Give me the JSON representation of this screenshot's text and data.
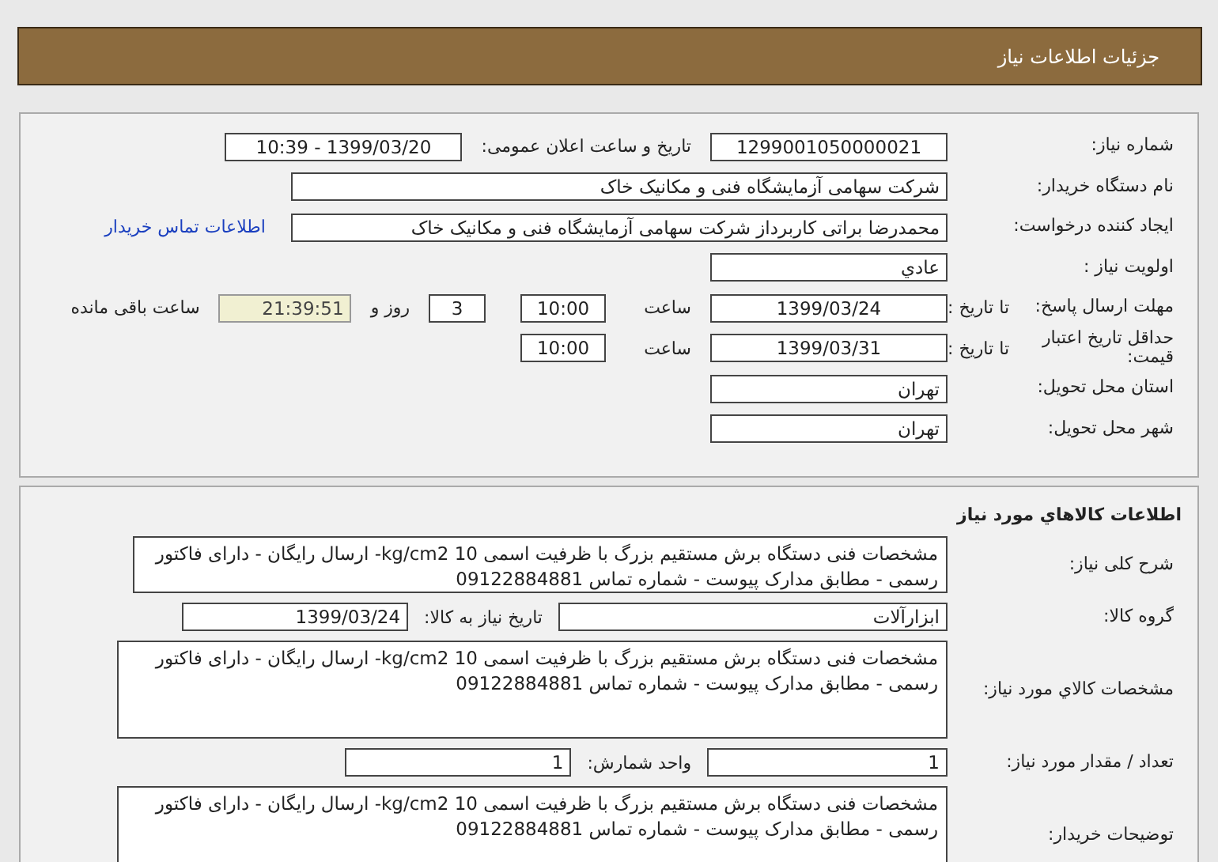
{
  "header": {
    "title": "جزئیات اطلاعات نیاز"
  },
  "request_panel": {
    "rows": [
      {
        "label": "شماره نیاز:",
        "items": [
          {
            "kind": "field",
            "value": "1299001050000021"
          },
          {
            "kind": "label",
            "text": "تاریخ و ساعت اعلان عمومی:"
          },
          {
            "kind": "field",
            "value": "1399/03/20 - 10:39"
          }
        ]
      },
      {
        "label": "نام دستگاه خریدار:",
        "items": [
          {
            "kind": "widefield",
            "value": "شرکت سهامی آزمایشگاه فنی و مکانیک خاک"
          }
        ]
      },
      {
        "label": "ایجاد کننده درخواست:",
        "items": [
          {
            "kind": "widefield",
            "value": "محمدرضا براتی کاربرداز  شرکت سهامی آزمایشگاه فنی و مکانیک خاک"
          },
          {
            "kind": "link",
            "text": "اطلاعات تماس خریدار"
          }
        ]
      },
      {
        "label": "اولویت نیاز :",
        "items": [
          {
            "kind": "field",
            "value": "عادي"
          }
        ]
      },
      {
        "label": "مهلت ارسال پاسخ:",
        "sublabel": "تا تاریخ :",
        "items": [
          {
            "kind": "field",
            "value": "1399/03/24"
          },
          {
            "kind": "label",
            "text": "ساعت"
          },
          {
            "kind": "smallfield",
            "value": "10:00"
          },
          {
            "kind": "days",
            "value": "3"
          },
          {
            "kind": "label",
            "text": "روز و"
          },
          {
            "kind": "timer",
            "value": "21:39:51"
          },
          {
            "kind": "label",
            "text": "ساعت باقی مانده"
          }
        ]
      },
      {
        "label": "حداقل تاریخ اعتبار قیمت:",
        "sublabel": "تا تاریخ :",
        "items": [
          {
            "kind": "field",
            "value": "1399/03/31"
          },
          {
            "kind": "label",
            "text": "ساعت"
          },
          {
            "kind": "smallfield",
            "value": "10:00"
          }
        ]
      },
      {
        "label": "استان محل تحویل:",
        "items": [
          {
            "kind": "field",
            "value": "تهران"
          }
        ]
      },
      {
        "label": "شهر محل تحویل:",
        "items": [
          {
            "kind": "field",
            "value": "تهران"
          }
        ]
      }
    ]
  },
  "goods_panel": {
    "heading": "اطلاعات کالاهاي مورد نياز",
    "rows": [
      {
        "label": "شرح کلی نیاز:",
        "items": [
          {
            "kind": "textarea",
            "value": "مشخصات فنی دستگاه برش مستقیم بزرگ با ظرفیت اسمی kg/cm2 10- ارسال رایگان - دارای فاکتور رسمی - مطابق مدارک پیوست - شماره تماس 09122884881"
          }
        ]
      },
      {
        "label": "گروه کالا:",
        "items": [
          {
            "kind": "groupfield",
            "value": "ابزارآلات"
          },
          {
            "kind": "label",
            "text": "تاریخ نیاز به کالا:"
          },
          {
            "kind": "datefield",
            "value": "1399/03/24"
          }
        ]
      },
      {
        "label": "مشخصات کالاي مورد نياز:",
        "items": [
          {
            "kind": "bigtextarea",
            "value": "مشخصات فنی دستگاه برش مستقیم بزرگ با ظرفیت اسمی kg/cm2 10- ارسال رایگان - دارای فاکتور رسمی - مطابق مدارک پیوست - شماره تماس 09122884881"
          }
        ]
      },
      {
        "label": "تعداد / مقدار مورد نیاز:",
        "items": [
          {
            "kind": "qtyfield",
            "value": "1"
          },
          {
            "kind": "label",
            "text": "واحد شمارش:"
          },
          {
            "kind": "datefield",
            "value": "1"
          }
        ]
      },
      {
        "label": "توضیحات خریدار:",
        "items": [
          {
            "kind": "bigtextarea",
            "value": "مشخصات فنی دستگاه برش مستقیم بزرگ با ظرفیت اسمی kg/cm2 10- ارسال رایگان - دارای فاکتور رسمی - مطابق مدارک پیوست - شماره تماس 09122884881"
          }
        ]
      }
    ]
  }
}
